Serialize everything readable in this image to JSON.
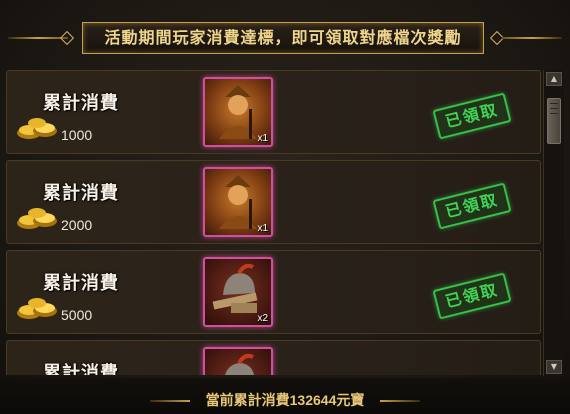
{
  "banner": {
    "text": "活動期間玩家消費達標，即可領取對應檔次獎勵"
  },
  "tiers": [
    {
      "title": "累計消費",
      "amount": "1000",
      "item_qty": "x1",
      "status": "已領取"
    },
    {
      "title": "累計消費",
      "amount": "2000",
      "item_qty": "x1",
      "status": "已領取"
    },
    {
      "title": "累計消費",
      "amount": "5000",
      "item_qty": "x2",
      "status": "已領取"
    },
    {
      "title": "累計消費"
    }
  ],
  "footer": {
    "prefix": "當前累計消費",
    "total": "132644",
    "suffix": "元寶"
  },
  "colors": {
    "gold": "#f0d58c",
    "stamp_green": "#3fd455",
    "item_border": "#d24fa0"
  },
  "icons": {
    "currency": "gold-ingot-icon",
    "reward_1": "warrior-portrait-icon",
    "reward_3": "helmet-icon"
  }
}
